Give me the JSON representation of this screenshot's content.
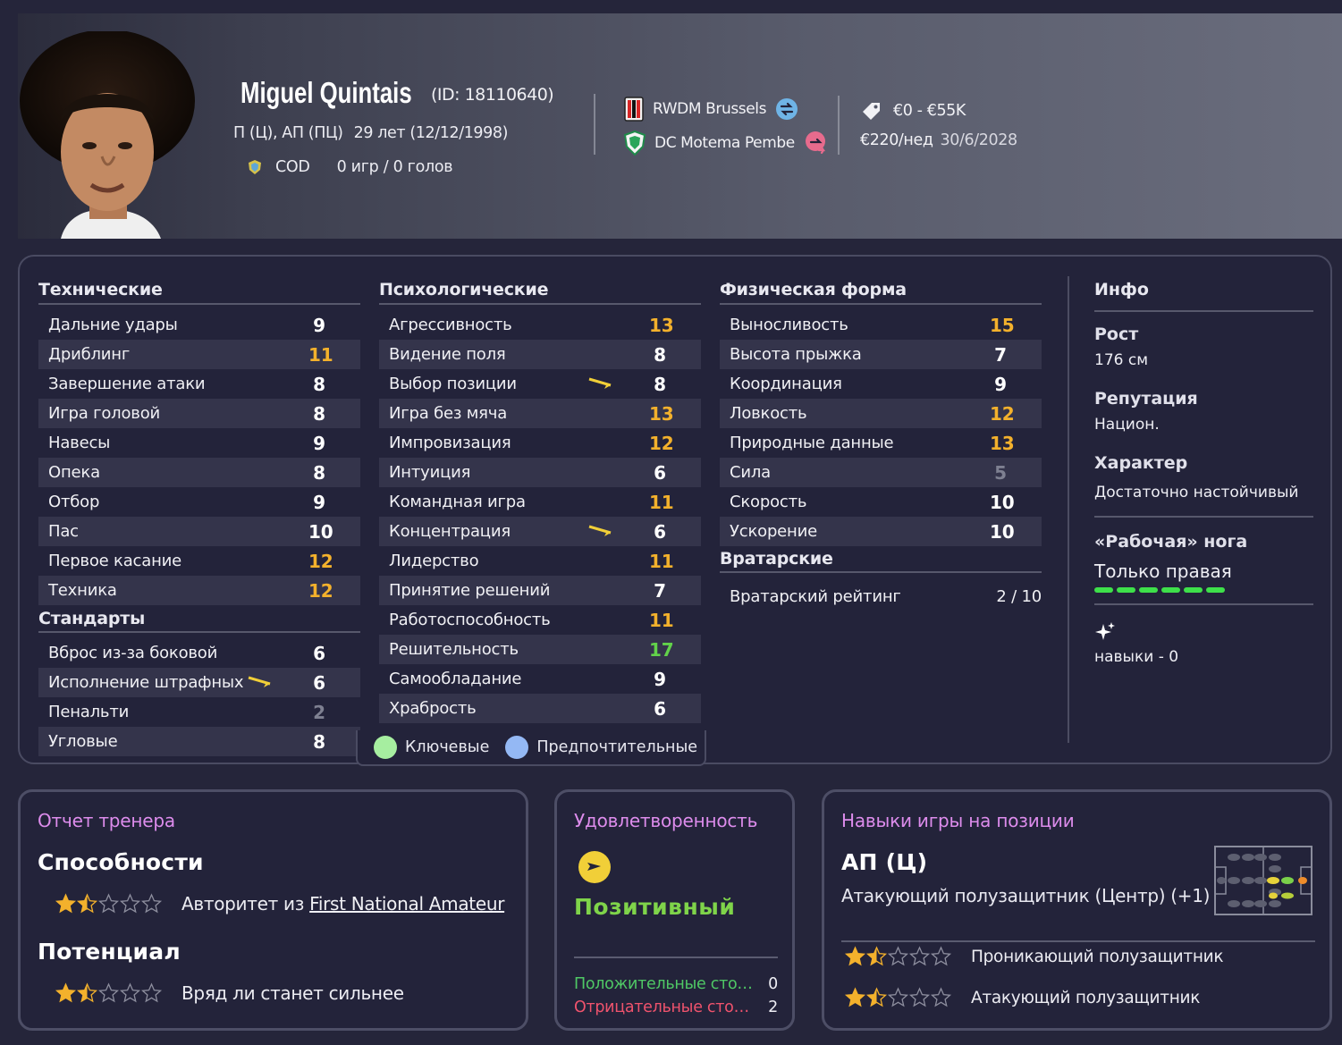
{
  "player": {
    "name": "Miguel Quintais",
    "id": "(ID: 18110640)",
    "positions": "П (Ц), АП (ПЦ)",
    "age": "29 лет (12/12/1998)",
    "nation": "COD",
    "caps": "0 игр / 0 голов"
  },
  "clubs": {
    "parent": "RWDM Brussels",
    "loan": "DC Motema Pembe"
  },
  "contract": {
    "value": "€0 - €55K",
    "wage": "€220/нед",
    "expires": "30/6/2028"
  },
  "technical": {
    "title": "Технические",
    "rows": [
      {
        "name": "Дальние удары",
        "value": "9",
        "tone": "white"
      },
      {
        "name": "Дриблинг",
        "value": "11",
        "tone": "gold"
      },
      {
        "name": "Завершение атаки",
        "value": "8",
        "tone": "white"
      },
      {
        "name": "Игра головой",
        "value": "8",
        "tone": "white"
      },
      {
        "name": "Навесы",
        "value": "9",
        "tone": "white"
      },
      {
        "name": "Опека",
        "value": "8",
        "tone": "white"
      },
      {
        "name": "Отбор",
        "value": "9",
        "tone": "white"
      },
      {
        "name": "Пас",
        "value": "10",
        "tone": "white"
      },
      {
        "name": "Первое касание",
        "value": "12",
        "tone": "gold"
      },
      {
        "name": "Техника",
        "value": "12",
        "tone": "gold"
      }
    ]
  },
  "setpieces": {
    "title": "Стандарты",
    "rows": [
      {
        "name": "Вброс из-за боковой",
        "value": "6",
        "tone": "white"
      },
      {
        "name": "Исполнение штрафных",
        "value": "6",
        "tone": "white",
        "arrow": true
      },
      {
        "name": "Пенальти",
        "value": "2",
        "tone": "grey"
      },
      {
        "name": "Угловые",
        "value": "8",
        "tone": "white"
      }
    ]
  },
  "mental": {
    "title": "Психологические",
    "rows": [
      {
        "name": "Агрессивность",
        "value": "13",
        "tone": "gold"
      },
      {
        "name": "Видение поля",
        "value": "8",
        "tone": "white"
      },
      {
        "name": "Выбор позиции",
        "value": "8",
        "tone": "white",
        "arrow": true
      },
      {
        "name": "Игра без мяча",
        "value": "13",
        "tone": "gold"
      },
      {
        "name": "Импровизация",
        "value": "12",
        "tone": "gold"
      },
      {
        "name": "Интуиция",
        "value": "6",
        "tone": "white"
      },
      {
        "name": "Командная игра",
        "value": "11",
        "tone": "gold"
      },
      {
        "name": "Концентрация",
        "value": "6",
        "tone": "white",
        "arrow": true
      },
      {
        "name": "Лидерство",
        "value": "11",
        "tone": "gold"
      },
      {
        "name": "Принятие решений",
        "value": "7",
        "tone": "white"
      },
      {
        "name": "Работоспособность",
        "value": "11",
        "tone": "gold"
      },
      {
        "name": "Решительность",
        "value": "17",
        "tone": "green"
      },
      {
        "name": "Самообладание",
        "value": "9",
        "tone": "white"
      },
      {
        "name": "Храбрость",
        "value": "6",
        "tone": "white"
      }
    ]
  },
  "physical": {
    "title": "Физическая форма",
    "rows": [
      {
        "name": "Выносливость",
        "value": "15",
        "tone": "gold"
      },
      {
        "name": "Высота прыжка",
        "value": "7",
        "tone": "white"
      },
      {
        "name": "Координация",
        "value": "9",
        "tone": "white"
      },
      {
        "name": "Ловкость",
        "value": "12",
        "tone": "gold"
      },
      {
        "name": "Природные данные",
        "value": "13",
        "tone": "gold"
      },
      {
        "name": "Сила",
        "value": "5",
        "tone": "grey"
      },
      {
        "name": "Скорость",
        "value": "10",
        "tone": "white"
      },
      {
        "name": "Ускорение",
        "value": "10",
        "tone": "white"
      }
    ]
  },
  "goalkeeping": {
    "title": "Вратарские",
    "label": "Вратарский рейтинг",
    "value": "2 / 10"
  },
  "info": {
    "title": "Инфо",
    "height_label": "Рост",
    "height": "176 см",
    "reputation_label": "Репутация",
    "reputation": "Национ.",
    "personality_label": "Характер",
    "personality": "Достаточно настойчивый",
    "foot_label": "«Рабочая» нога",
    "foot": "Только правая",
    "foot_level": 1.0,
    "traits": "навыки - 0"
  },
  "legend": {
    "key": "Ключевые",
    "preferred": "Предпочтительные",
    "key_color": "#a6eea0",
    "preferred_color": "#94b8f4"
  },
  "coach_report": {
    "title": "Отчет тренера",
    "ability_label": "Способности",
    "ability_stars": 1.5,
    "ability_text": "Авторитет из",
    "ability_link": "First National Amateur",
    "potential_label": "Потенциал",
    "potential_stars": 1.5,
    "potential_text": "Вряд ли станет сильнее"
  },
  "happiness": {
    "title": "Удовлетворенность",
    "status": "Позитивный",
    "positive_label": "Положительные стороны",
    "positive_count": "0",
    "negative_label": "Отрицательные стороны",
    "negative_count": "2"
  },
  "position_skills": {
    "title": "Навыки игры на позиции",
    "position": "АП (Ц)",
    "description": "Атакующий полузащитник (Центр) (+1)",
    "roles": [
      {
        "name": "Проникающий полузащитник",
        "stars": 1.5
      },
      {
        "name": "Атакующий полузащитник",
        "stars": 1.5
      }
    ]
  },
  "colors": {
    "accent_pink": "#dd8cec",
    "gold": "#f3b12c",
    "green": "#62d24a",
    "star": "#f3b12c"
  }
}
